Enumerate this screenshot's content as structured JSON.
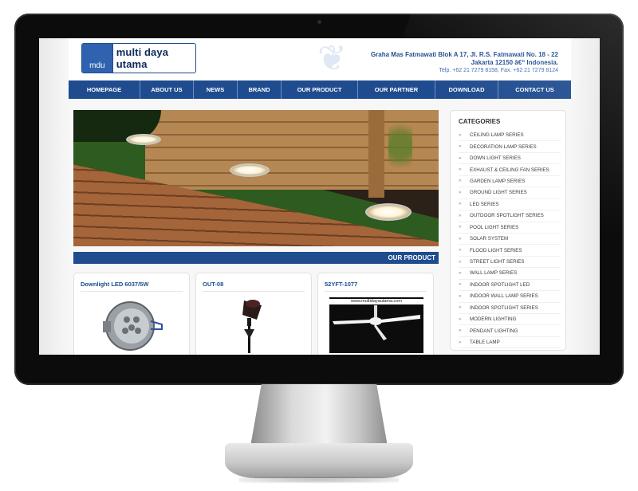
{
  "header": {
    "logo_abbr": "mdu",
    "logo_name": "multi daya utama",
    "address_line1": "Graha Mas Fatmawati Blok A 17, Jl. R.S. Fatmawati No. 18 - 22",
    "address_line2": "Jakarta 12150 â€“ Indonesia.",
    "contact_line": "Telp. +62 21 7279 8158, Fax. +62 21 7279 8124"
  },
  "nav": {
    "items": [
      "HOMEPAGE",
      "ABOUT US",
      "NEWS",
      "BRAND",
      "OUR PRODUCT",
      "OUR PARTNER",
      "DOWNLOAD",
      "CONTACT US"
    ]
  },
  "section": {
    "title": "OUR PRODUCT"
  },
  "products": [
    {
      "name": "Downlight LED 6037/5W"
    },
    {
      "name": "OUT-08"
    },
    {
      "name": "52YFT-1077",
      "image_caption": "www.multidayautama.com"
    }
  ],
  "categories": {
    "title": "CATEGORIES",
    "bullet": "»",
    "items": [
      "CEILING LAMP SERIES",
      "DECORATION LAMP SERIES",
      "DOWN LIGHT SERIES",
      "EXHAUST & CEILING FAN SERIES",
      "GARDEN LAMP SERIES",
      "GROUND LIGHT SERIES",
      "LED SERIES",
      "OUTDOOR SPOTLIGHT SERIES",
      "POOL LIGHT SERIES",
      "SOLAR SYSTEM",
      "FLOOD LIGHT SERIES",
      "STREET LIGHT SERIES",
      "WALL LAMP SERIES",
      "INDOOR SPOTLIGHT LED",
      "INDOOR WALL LAMP SERIES",
      "INDOOR SPOTLIGHT SERIES",
      "MODERN LIGHTING",
      "PENDANT LIGHTING",
      "TABLE LAMP"
    ]
  },
  "colors": {
    "brand_blue": "#1f4c8f",
    "bezel": "#0c0c0c"
  }
}
